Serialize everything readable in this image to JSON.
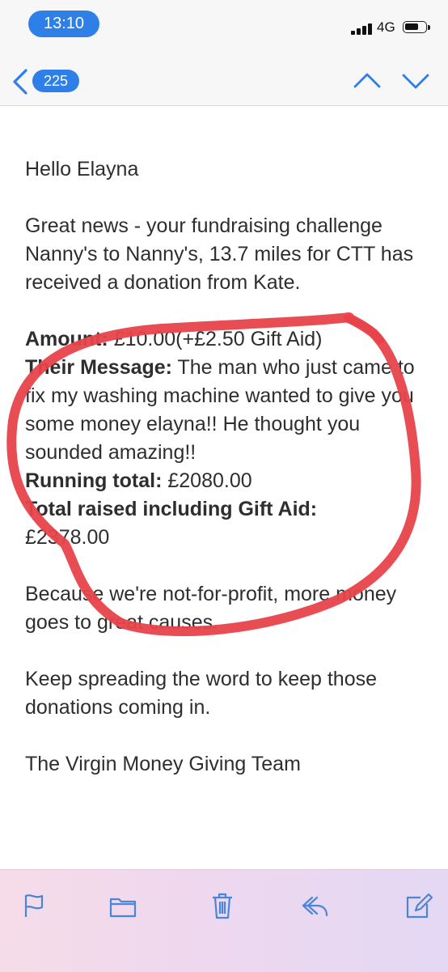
{
  "status_bar": {
    "time": "13:10",
    "network": "4G"
  },
  "nav": {
    "message_count": "225"
  },
  "email": {
    "greeting": "Hello Elayna",
    "intro": "Great news - your fundraising challenge Nanny's to Nanny's, 13.7 miles for CTT has received a donation from Kate.",
    "amount_label": "Amount:",
    "amount_value": " £10.00(+£2.50 Gift Aid)",
    "message_label": "Their Message:",
    "message_value": " The man who just came to fix my washing machine wanted to give you some money elayna!! He thought you sounded amazing!!",
    "running_label": "Running total:",
    "running_value": " £2080.00",
    "total_label": "Total raised including Gift Aid:",
    "total_value": "£2378.00",
    "para_nonprofit": "Because we're not-for-profit, more money goes to great causes.",
    "para_spread": "Keep spreading the word to keep those donations coming in.",
    "signoff": "The Virgin Money Giving Team"
  },
  "toolbar": {
    "icons": [
      "flag-icon",
      "folder-icon",
      "trash-icon",
      "reply-icon",
      "compose-icon"
    ]
  },
  "colors": {
    "accent": "#2f7fe8",
    "annotation": "#e8434b",
    "toolbar_tint": "#eed8ef"
  }
}
